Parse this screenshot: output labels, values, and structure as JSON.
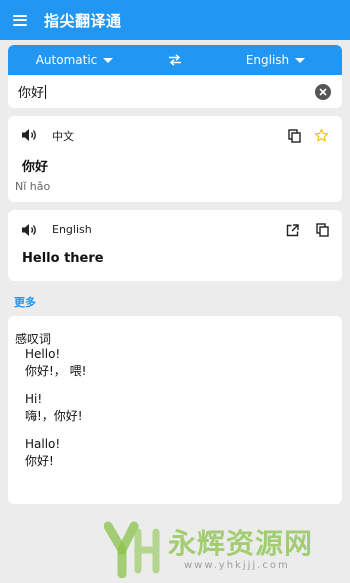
{
  "app": {
    "title": "指尖翻译通"
  },
  "language_bar": {
    "source": "Automatic",
    "target": "English"
  },
  "input": {
    "value": "你好"
  },
  "source_card": {
    "language": "中文",
    "text": "你好",
    "pinyin": "Nǐ hǎo"
  },
  "target_card": {
    "language": "English",
    "text": "Hello there"
  },
  "more": {
    "label": "更多"
  },
  "dictionary": {
    "title": "感叹词",
    "lines": [
      "Hello!",
      "你好!， 喂!",
      "",
      "Hi!",
      "嗨!，你好!",
      "",
      "Hallo!",
      "你好!"
    ]
  },
  "watermark": {
    "text": "永辉资源网",
    "url": "www.yhkjjj.com"
  },
  "colors": {
    "primary": "#2196f3",
    "star": "#f5c518",
    "watermark": "#8bc34a"
  }
}
